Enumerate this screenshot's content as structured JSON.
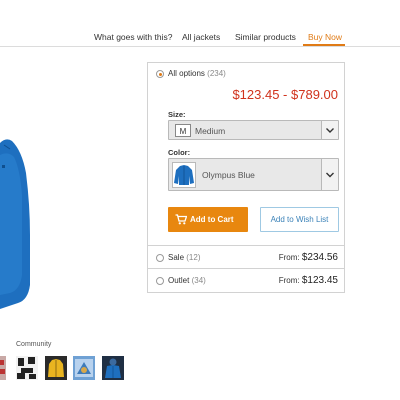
{
  "nav": {
    "tabs": [
      {
        "label": "What goes with this?",
        "active": false
      },
      {
        "label": "All jackets",
        "active": false
      },
      {
        "label": "Similar products",
        "active": false
      },
      {
        "label": "Buy Now",
        "active": true
      }
    ]
  },
  "colors": {
    "accent": "#e07b16",
    "price": "#d0321c",
    "cart_button": "#e8870f",
    "link": "#3b82b8",
    "jacket": "#1e6fbf"
  },
  "buy_panel": {
    "all_options": {
      "label": "All options",
      "count": "(234)",
      "selected": true
    },
    "price_range": "$123.45 - $789.00",
    "size": {
      "label": "Size:",
      "badge": "M",
      "value": "Medium"
    },
    "color": {
      "label": "Color:",
      "value": "Olympus Blue"
    },
    "add_to_cart": "Add to Cart",
    "add_to_wishlist": "Add to Wish List",
    "sale": {
      "label": "Sale",
      "count": "(12)",
      "from": "From:",
      "price": "$234.56",
      "selected": false
    },
    "outlet": {
      "label": "Outlet",
      "count": "(34)",
      "from": "From:",
      "price": "$123.45",
      "selected": false
    }
  },
  "community": {
    "label": "Community",
    "thumbnails": [
      "red-pattern-thumbnail",
      "black-white-pattern-thumbnail",
      "yellow-jacket-thumbnail",
      "blue-pattern-thumbnail",
      "blue-jacket-thumbnail"
    ]
  }
}
